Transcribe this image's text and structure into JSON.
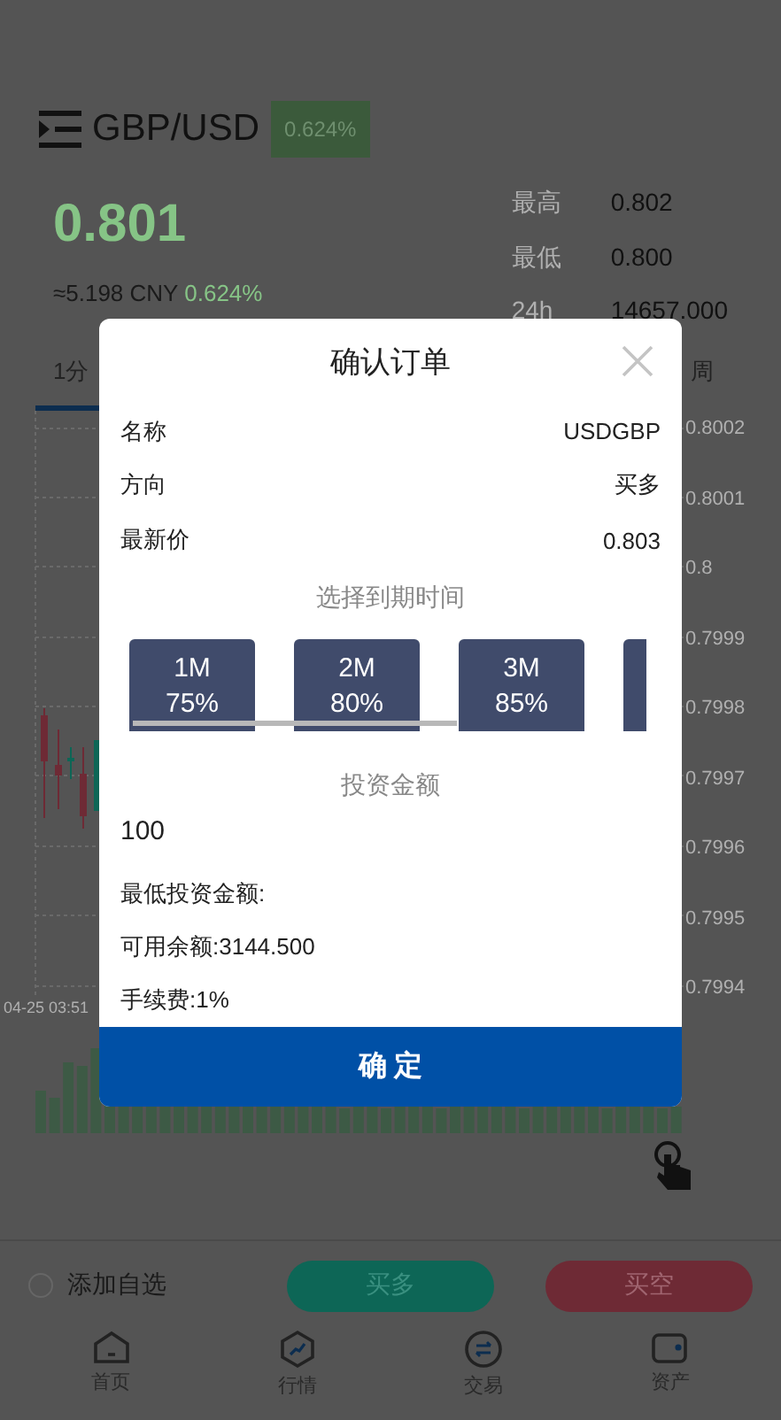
{
  "header": {
    "symbol": "GBP/USD",
    "change_badge": "0.624%"
  },
  "quote": {
    "price": "0.801",
    "cny": "≈5.198 CNY",
    "change": "0.624%",
    "stats": [
      {
        "label": "最高",
        "value": "0.802"
      },
      {
        "label": "最低",
        "value": "0.800"
      },
      {
        "label": "24h",
        "value": "14657.000"
      }
    ]
  },
  "intervals": [
    {
      "label": "1分",
      "selected": true
    },
    {
      "label": "周",
      "selected": false
    }
  ],
  "chart": {
    "y_labels": [
      "0.8002",
      "0.8001",
      "0.8",
      "0.7999",
      "0.7998",
      "0.7997",
      "0.7996",
      "0.7995",
      "0.7994"
    ],
    "x_label": "04-25 03:51"
  },
  "dialog": {
    "title": "确认订单",
    "rows": [
      {
        "label": "名称",
        "value": "USDGBP"
      },
      {
        "label": "方向",
        "value": "买多"
      },
      {
        "label": "最新价",
        "value": "0.803"
      }
    ],
    "period_heading": "选择到期时间",
    "periods": [
      {
        "time": "1M",
        "rate": "75%"
      },
      {
        "time": "2M",
        "rate": "80%"
      },
      {
        "time": "3M",
        "rate": "85%"
      }
    ],
    "amount_heading": "投资金额",
    "amount": "100",
    "notes": [
      "最低投资金额:",
      "可用余额:3144.500",
      "手续费:1%"
    ],
    "confirm": "确 定"
  },
  "actions": {
    "favorite": {
      "label": "添加自选",
      "checked": false
    },
    "buy": "买多",
    "sell": "买空"
  },
  "nav": [
    {
      "label": "首页",
      "kind": "home"
    },
    {
      "label": "行情",
      "kind": "market"
    },
    {
      "label": "交易",
      "kind": "trade"
    },
    {
      "label": "资产",
      "kind": "wallet"
    }
  ]
}
